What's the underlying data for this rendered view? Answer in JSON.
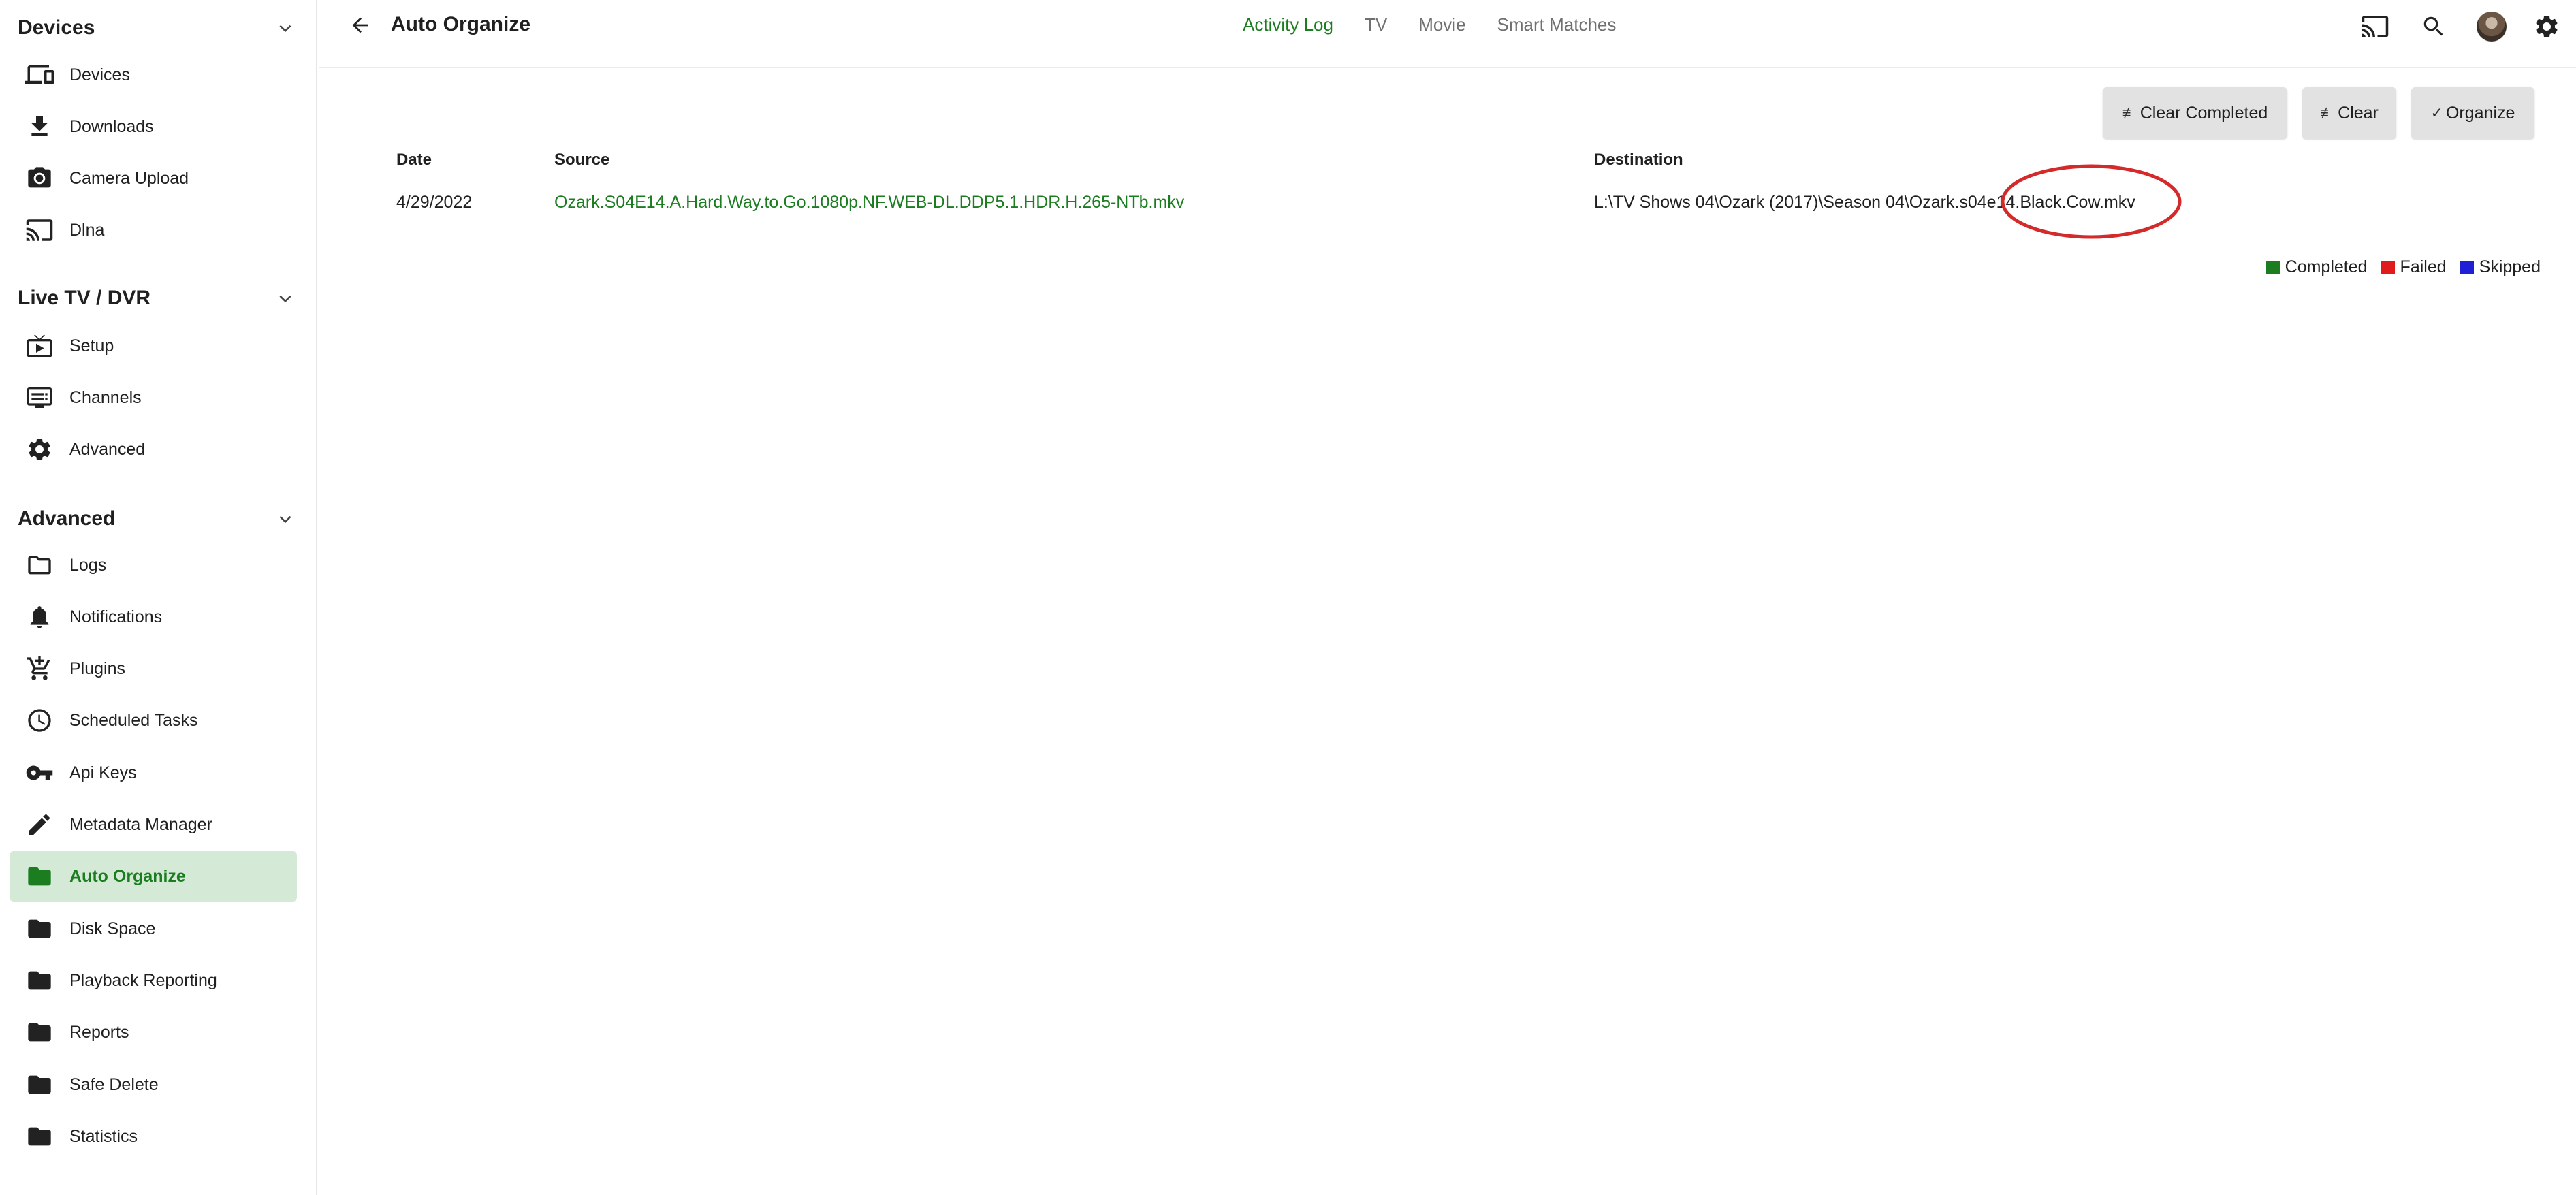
{
  "sidebar": {
    "sections": [
      {
        "title": "Devices",
        "items": [
          {
            "label": "Devices",
            "icon": "devices-icon"
          },
          {
            "label": "Downloads",
            "icon": "download-icon"
          },
          {
            "label": "Camera Upload",
            "icon": "camera-icon"
          },
          {
            "label": "Dlna",
            "icon": "dlna-icon"
          }
        ]
      },
      {
        "title": "Live TV / DVR",
        "items": [
          {
            "label": "Setup",
            "icon": "tv-setup-icon"
          },
          {
            "label": "Channels",
            "icon": "channels-icon"
          },
          {
            "label": "Advanced",
            "icon": "gear-icon"
          }
        ]
      },
      {
        "title": "Advanced",
        "items": [
          {
            "label": "Logs",
            "icon": "folder-outline-icon"
          },
          {
            "label": "Notifications",
            "icon": "bell-icon"
          },
          {
            "label": "Plugins",
            "icon": "cart-plus-icon"
          },
          {
            "label": "Scheduled Tasks",
            "icon": "clock-icon"
          },
          {
            "label": "Api Keys",
            "icon": "key-icon"
          },
          {
            "label": "Metadata Manager",
            "icon": "pencil-icon"
          },
          {
            "label": "Auto Organize",
            "icon": "folder-icon",
            "active": true
          },
          {
            "label": "Disk Space",
            "icon": "folder-icon"
          },
          {
            "label": "Playback Reporting",
            "icon": "folder-icon"
          },
          {
            "label": "Reports",
            "icon": "folder-icon"
          },
          {
            "label": "Safe Delete",
            "icon": "folder-icon"
          },
          {
            "label": "Statistics",
            "icon": "folder-icon"
          }
        ]
      }
    ]
  },
  "header": {
    "title": "Auto Organize",
    "tabs": [
      {
        "label": "Activity Log",
        "active": true
      },
      {
        "label": "TV",
        "active": false
      },
      {
        "label": "Movie",
        "active": false
      },
      {
        "label": "Smart Matches",
        "active": false
      }
    ],
    "icons": [
      "cast-icon",
      "search-icon",
      "user-avatar",
      "settings-gear-icon"
    ]
  },
  "actions": {
    "clear_completed": "Clear Completed",
    "clear": "Clear",
    "organize": "Organize"
  },
  "table": {
    "columns": [
      "Date",
      "Source",
      "Destination"
    ],
    "rows": [
      {
        "date": "4/29/2022",
        "source": "Ozark.S04E14.A.Hard.Way.to.Go.1080p.NF.WEB-DL.DDP5.1.HDR.H.265-NTb.mkv",
        "destination": "L:\\TV Shows 04\\Ozark (2017)\\Season 04\\Ozark.s04e14.Black.Cow.mkv"
      }
    ]
  },
  "legend": [
    {
      "label": "Completed",
      "color": "#1b7d20"
    },
    {
      "label": "Failed",
      "color": "#e01b1b"
    },
    {
      "label": "Skipped",
      "color": "#1f1fd6"
    }
  ],
  "colors": {
    "accent": "#1b7d20",
    "active_bg": "#d4ead6",
    "annotation": "#d42a2a"
  }
}
